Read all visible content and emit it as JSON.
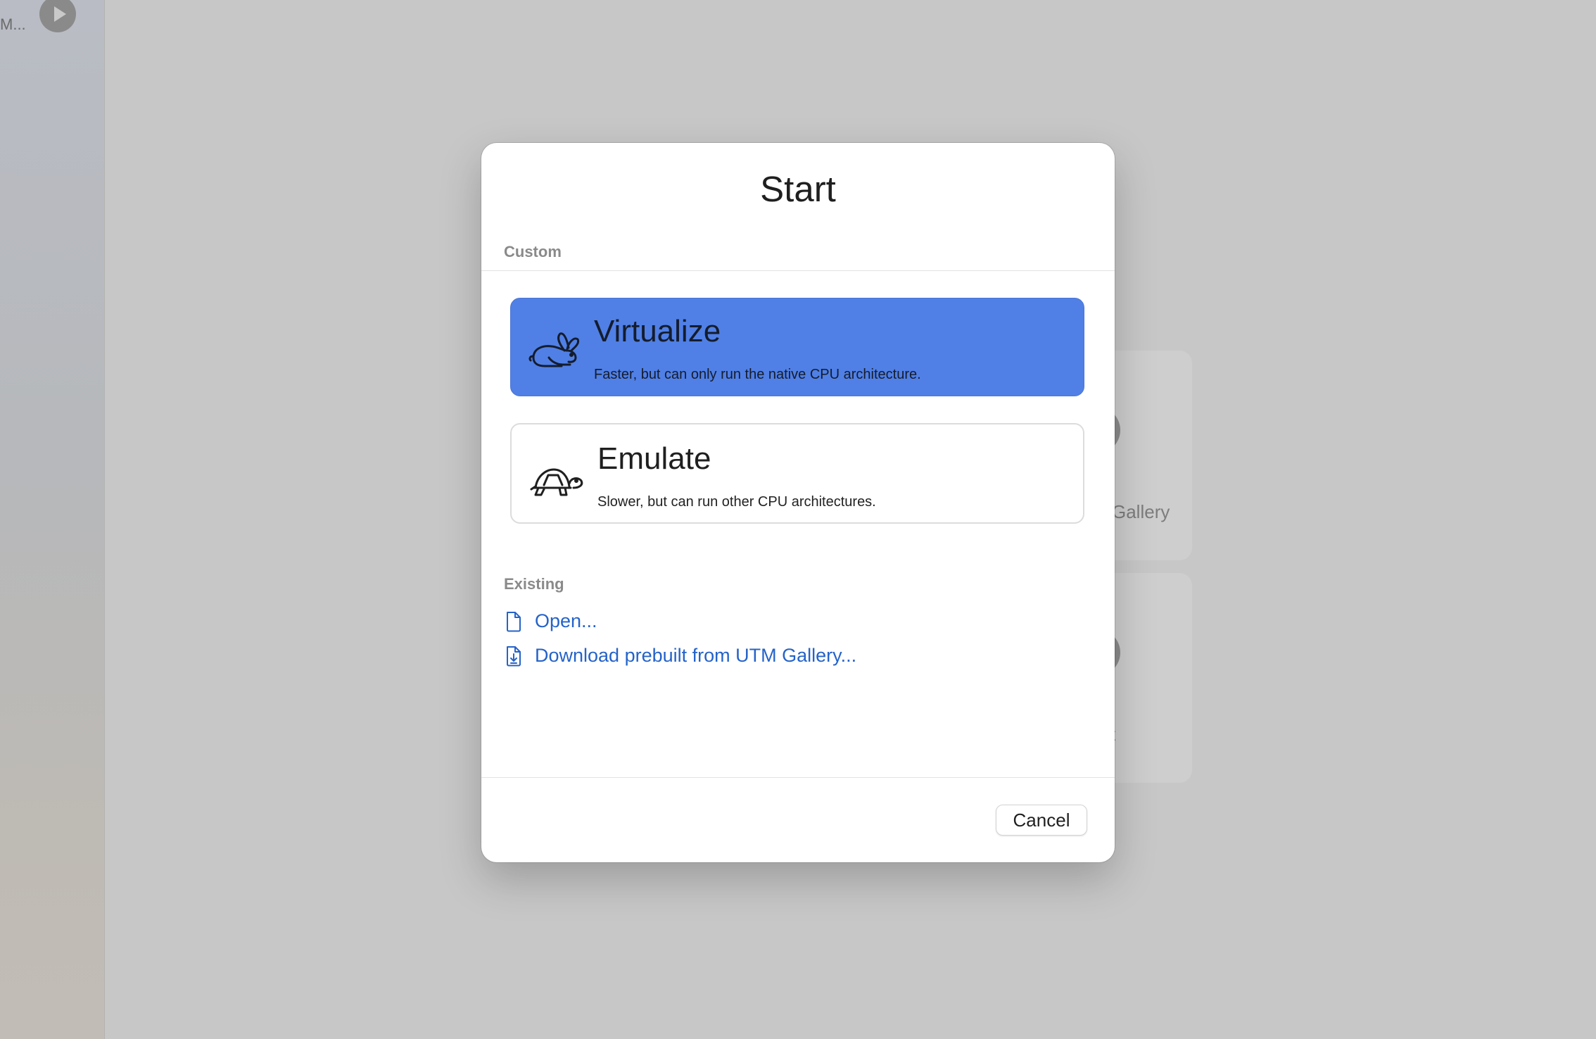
{
  "background": {
    "sidebar_vm_name": "M...",
    "card_texts": [
      "Gallery",
      "t"
    ]
  },
  "sheet": {
    "title": "Start",
    "custom_section": {
      "label": "Custom",
      "options": [
        {
          "title": "Virtualize",
          "description": "Faster, but can only run the native CPU architecture.",
          "icon": "hare-icon",
          "selected": true
        },
        {
          "title": "Emulate",
          "description": "Slower, but can run other CPU architectures.",
          "icon": "tortoise-icon",
          "selected": false
        }
      ]
    },
    "existing_section": {
      "label": "Existing",
      "links": [
        {
          "label": "Open...",
          "icon": "document-icon"
        },
        {
          "label": "Download prebuilt from UTM Gallery...",
          "icon": "download-document-icon"
        }
      ]
    },
    "cancel_label": "Cancel"
  },
  "colors": {
    "accent": "#5080e5",
    "link": "#2563c9",
    "backdrop": "#c7c7c7"
  }
}
